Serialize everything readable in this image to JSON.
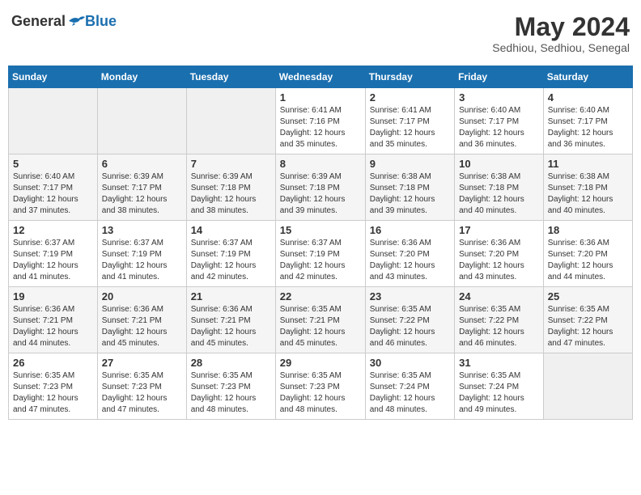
{
  "header": {
    "logo_general": "General",
    "logo_blue": "Blue",
    "month_title": "May 2024",
    "subtitle": "Sedhiou, Sedhiou, Senegal"
  },
  "days_of_week": [
    "Sunday",
    "Monday",
    "Tuesday",
    "Wednesday",
    "Thursday",
    "Friday",
    "Saturday"
  ],
  "weeks": [
    [
      {
        "day": "",
        "info": ""
      },
      {
        "day": "",
        "info": ""
      },
      {
        "day": "",
        "info": ""
      },
      {
        "day": "1",
        "info": "Sunrise: 6:41 AM\nSunset: 7:16 PM\nDaylight: 12 hours\nand 35 minutes."
      },
      {
        "day": "2",
        "info": "Sunrise: 6:41 AM\nSunset: 7:17 PM\nDaylight: 12 hours\nand 35 minutes."
      },
      {
        "day": "3",
        "info": "Sunrise: 6:40 AM\nSunset: 7:17 PM\nDaylight: 12 hours\nand 36 minutes."
      },
      {
        "day": "4",
        "info": "Sunrise: 6:40 AM\nSunset: 7:17 PM\nDaylight: 12 hours\nand 36 minutes."
      }
    ],
    [
      {
        "day": "5",
        "info": "Sunrise: 6:40 AM\nSunset: 7:17 PM\nDaylight: 12 hours\nand 37 minutes."
      },
      {
        "day": "6",
        "info": "Sunrise: 6:39 AM\nSunset: 7:17 PM\nDaylight: 12 hours\nand 38 minutes."
      },
      {
        "day": "7",
        "info": "Sunrise: 6:39 AM\nSunset: 7:18 PM\nDaylight: 12 hours\nand 38 minutes."
      },
      {
        "day": "8",
        "info": "Sunrise: 6:39 AM\nSunset: 7:18 PM\nDaylight: 12 hours\nand 39 minutes."
      },
      {
        "day": "9",
        "info": "Sunrise: 6:38 AM\nSunset: 7:18 PM\nDaylight: 12 hours\nand 39 minutes."
      },
      {
        "day": "10",
        "info": "Sunrise: 6:38 AM\nSunset: 7:18 PM\nDaylight: 12 hours\nand 40 minutes."
      },
      {
        "day": "11",
        "info": "Sunrise: 6:38 AM\nSunset: 7:18 PM\nDaylight: 12 hours\nand 40 minutes."
      }
    ],
    [
      {
        "day": "12",
        "info": "Sunrise: 6:37 AM\nSunset: 7:19 PM\nDaylight: 12 hours\nand 41 minutes."
      },
      {
        "day": "13",
        "info": "Sunrise: 6:37 AM\nSunset: 7:19 PM\nDaylight: 12 hours\nand 41 minutes."
      },
      {
        "day": "14",
        "info": "Sunrise: 6:37 AM\nSunset: 7:19 PM\nDaylight: 12 hours\nand 42 minutes."
      },
      {
        "day": "15",
        "info": "Sunrise: 6:37 AM\nSunset: 7:19 PM\nDaylight: 12 hours\nand 42 minutes."
      },
      {
        "day": "16",
        "info": "Sunrise: 6:36 AM\nSunset: 7:20 PM\nDaylight: 12 hours\nand 43 minutes."
      },
      {
        "day": "17",
        "info": "Sunrise: 6:36 AM\nSunset: 7:20 PM\nDaylight: 12 hours\nand 43 minutes."
      },
      {
        "day": "18",
        "info": "Sunrise: 6:36 AM\nSunset: 7:20 PM\nDaylight: 12 hours\nand 44 minutes."
      }
    ],
    [
      {
        "day": "19",
        "info": "Sunrise: 6:36 AM\nSunset: 7:21 PM\nDaylight: 12 hours\nand 44 minutes."
      },
      {
        "day": "20",
        "info": "Sunrise: 6:36 AM\nSunset: 7:21 PM\nDaylight: 12 hours\nand 45 minutes."
      },
      {
        "day": "21",
        "info": "Sunrise: 6:36 AM\nSunset: 7:21 PM\nDaylight: 12 hours\nand 45 minutes."
      },
      {
        "day": "22",
        "info": "Sunrise: 6:35 AM\nSunset: 7:21 PM\nDaylight: 12 hours\nand 45 minutes."
      },
      {
        "day": "23",
        "info": "Sunrise: 6:35 AM\nSunset: 7:22 PM\nDaylight: 12 hours\nand 46 minutes."
      },
      {
        "day": "24",
        "info": "Sunrise: 6:35 AM\nSunset: 7:22 PM\nDaylight: 12 hours\nand 46 minutes."
      },
      {
        "day": "25",
        "info": "Sunrise: 6:35 AM\nSunset: 7:22 PM\nDaylight: 12 hours\nand 47 minutes."
      }
    ],
    [
      {
        "day": "26",
        "info": "Sunrise: 6:35 AM\nSunset: 7:23 PM\nDaylight: 12 hours\nand 47 minutes."
      },
      {
        "day": "27",
        "info": "Sunrise: 6:35 AM\nSunset: 7:23 PM\nDaylight: 12 hours\nand 47 minutes."
      },
      {
        "day": "28",
        "info": "Sunrise: 6:35 AM\nSunset: 7:23 PM\nDaylight: 12 hours\nand 48 minutes."
      },
      {
        "day": "29",
        "info": "Sunrise: 6:35 AM\nSunset: 7:23 PM\nDaylight: 12 hours\nand 48 minutes."
      },
      {
        "day": "30",
        "info": "Sunrise: 6:35 AM\nSunset: 7:24 PM\nDaylight: 12 hours\nand 48 minutes."
      },
      {
        "day": "31",
        "info": "Sunrise: 6:35 AM\nSunset: 7:24 PM\nDaylight: 12 hours\nand 49 minutes."
      },
      {
        "day": "",
        "info": ""
      }
    ]
  ]
}
